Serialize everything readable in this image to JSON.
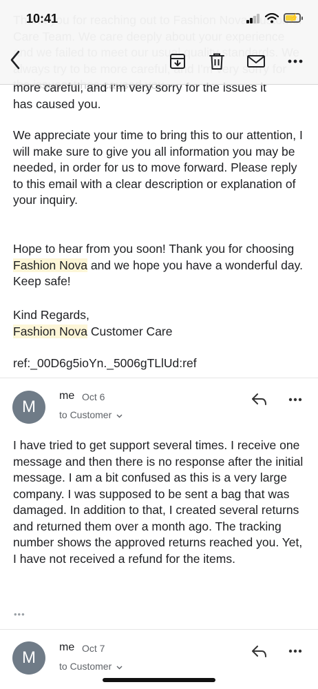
{
  "status": {
    "time": "10:41"
  },
  "background_text": "Thank you for reaching out to Fashion Nova Customer Care Team. We care deeply about your experience and we failed to meet our usual quality standards. We always try to be more careful, and I'm very sorry for the issues it has caused you.",
  "toolbar": {
    "back": "back-icon",
    "archive": "archive-icon",
    "delete": "trash-icon",
    "mark": "mail-icon",
    "more": "more-icon"
  },
  "first_message": {
    "line1": "more careful, and I'm very sorry for the issues it",
    "line2": "has caused you.",
    "para2": "We appreciate your time to bring this to our attention, I will make sure to give you all information you may be needed, in order for us to move forward. Please reply to this email with a clear description or explanation of your inquiry.",
    "para3_a": "Hope to hear from you soon! Thank you for choosing ",
    "brand": "Fashion Nova",
    "para3_b": " and we hope you have a wonderful day. Keep safe!",
    "regards": "Kind Regards,",
    "sig_brand": "Fashion Nova",
    "sig_rest": " Customer Care",
    "ref": "ref:_00D6g5ioYn._5006gTLlUd:ref"
  },
  "messages": [
    {
      "avatar": "M",
      "sender": "me",
      "date": "Oct 6",
      "to": "to Customer",
      "body": "I have tried to get support several times. I receive one message and then there is no response after the initial message. I am a bit confused as this is a very large company. I was supposed to be sent a bag that was damaged. In addition to that, I created several returns and returned them over a month ago. The tracking number shows the approved returns reached you. Yet, I have not received a refund for the items.",
      "collapsed": "•••"
    },
    {
      "avatar": "M",
      "sender": "me",
      "date": "Oct 7",
      "to": "to Customer"
    }
  ]
}
